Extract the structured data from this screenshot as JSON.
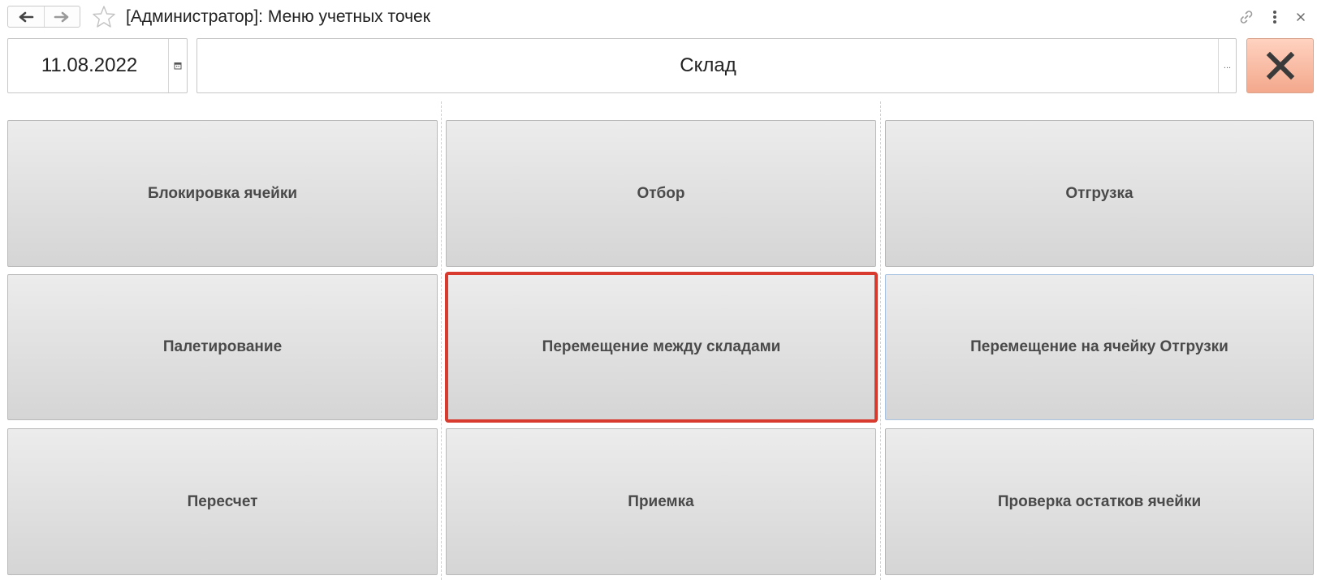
{
  "window": {
    "title": "[Администратор]: Меню учетных точек",
    "back_icon": "arrow-left-icon",
    "forward_icon": "arrow-right-icon",
    "favorite_icon": "star-icon",
    "link_icon": "link-icon",
    "more_icon": "more-vertical-icon",
    "close_icon": "close-icon"
  },
  "filters": {
    "date": "11.08.2022",
    "warehouse": "Склад",
    "warehouse_select_label": "...",
    "close_button_icon": "close-x-icon"
  },
  "menu": {
    "items": [
      {
        "label": "Блокировка ячейки"
      },
      {
        "label": "Отбор"
      },
      {
        "label": "Отгрузка"
      },
      {
        "label": "Палетирование"
      },
      {
        "label": "Перемещение между складами"
      },
      {
        "label": "Перемещение на ячейку Отгрузки"
      },
      {
        "label": "Пересчет"
      },
      {
        "label": "Приемка"
      },
      {
        "label": "Проверка остатков ячейки"
      }
    ],
    "focused_item": "Перемещение между складами"
  },
  "colors": {
    "focus_border": "#d93a2e",
    "close_button": "#f3a88c"
  }
}
